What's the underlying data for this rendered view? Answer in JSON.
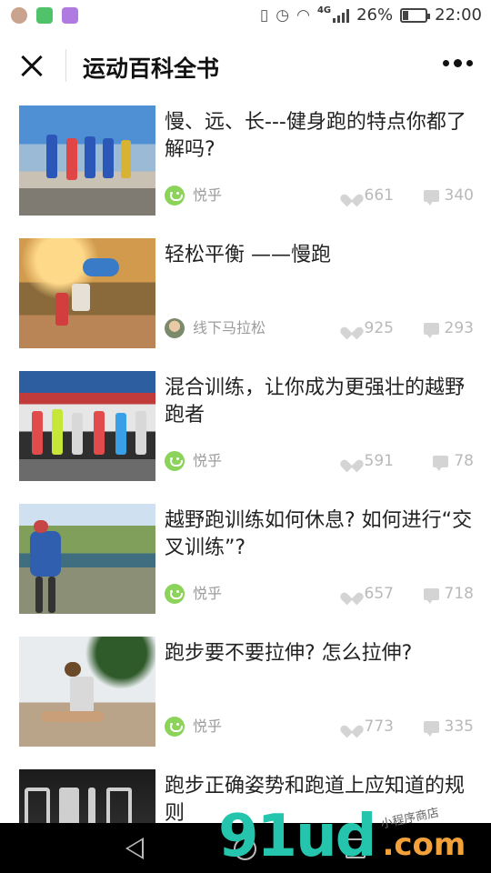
{
  "status_bar": {
    "network": "4G",
    "battery": "26%",
    "battery_level": 0.26,
    "time": "22:00"
  },
  "header": {
    "title": "运动百科全书"
  },
  "articles": [
    {
      "title": "慢、远、长---健身跑的特点你都了解吗?",
      "author": "悦乎",
      "likes": "661",
      "comments": "340"
    },
    {
      "title": "轻松平衡 ——慢跑",
      "author": "线下马拉松",
      "likes": "925",
      "comments": "293"
    },
    {
      "title": "混合训练，让你成为更强壮的越野跑者",
      "author": "悦乎",
      "likes": "591",
      "comments": "78"
    },
    {
      "title": "越野跑训练如何休息? 如何进行“交叉训练”?",
      "author": "悦乎",
      "likes": "657",
      "comments": "718"
    },
    {
      "title": "跑步要不要拉伸? 怎么拉伸?",
      "author": "悦乎",
      "likes": "773",
      "comments": "335"
    },
    {
      "title": "跑步正确姿势和跑道上应知道的规则",
      "author": "",
      "likes": "",
      "comments": ""
    }
  ],
  "watermark": {
    "number": "91ud",
    "domain": ".com",
    "tagline": "小程序商店"
  }
}
